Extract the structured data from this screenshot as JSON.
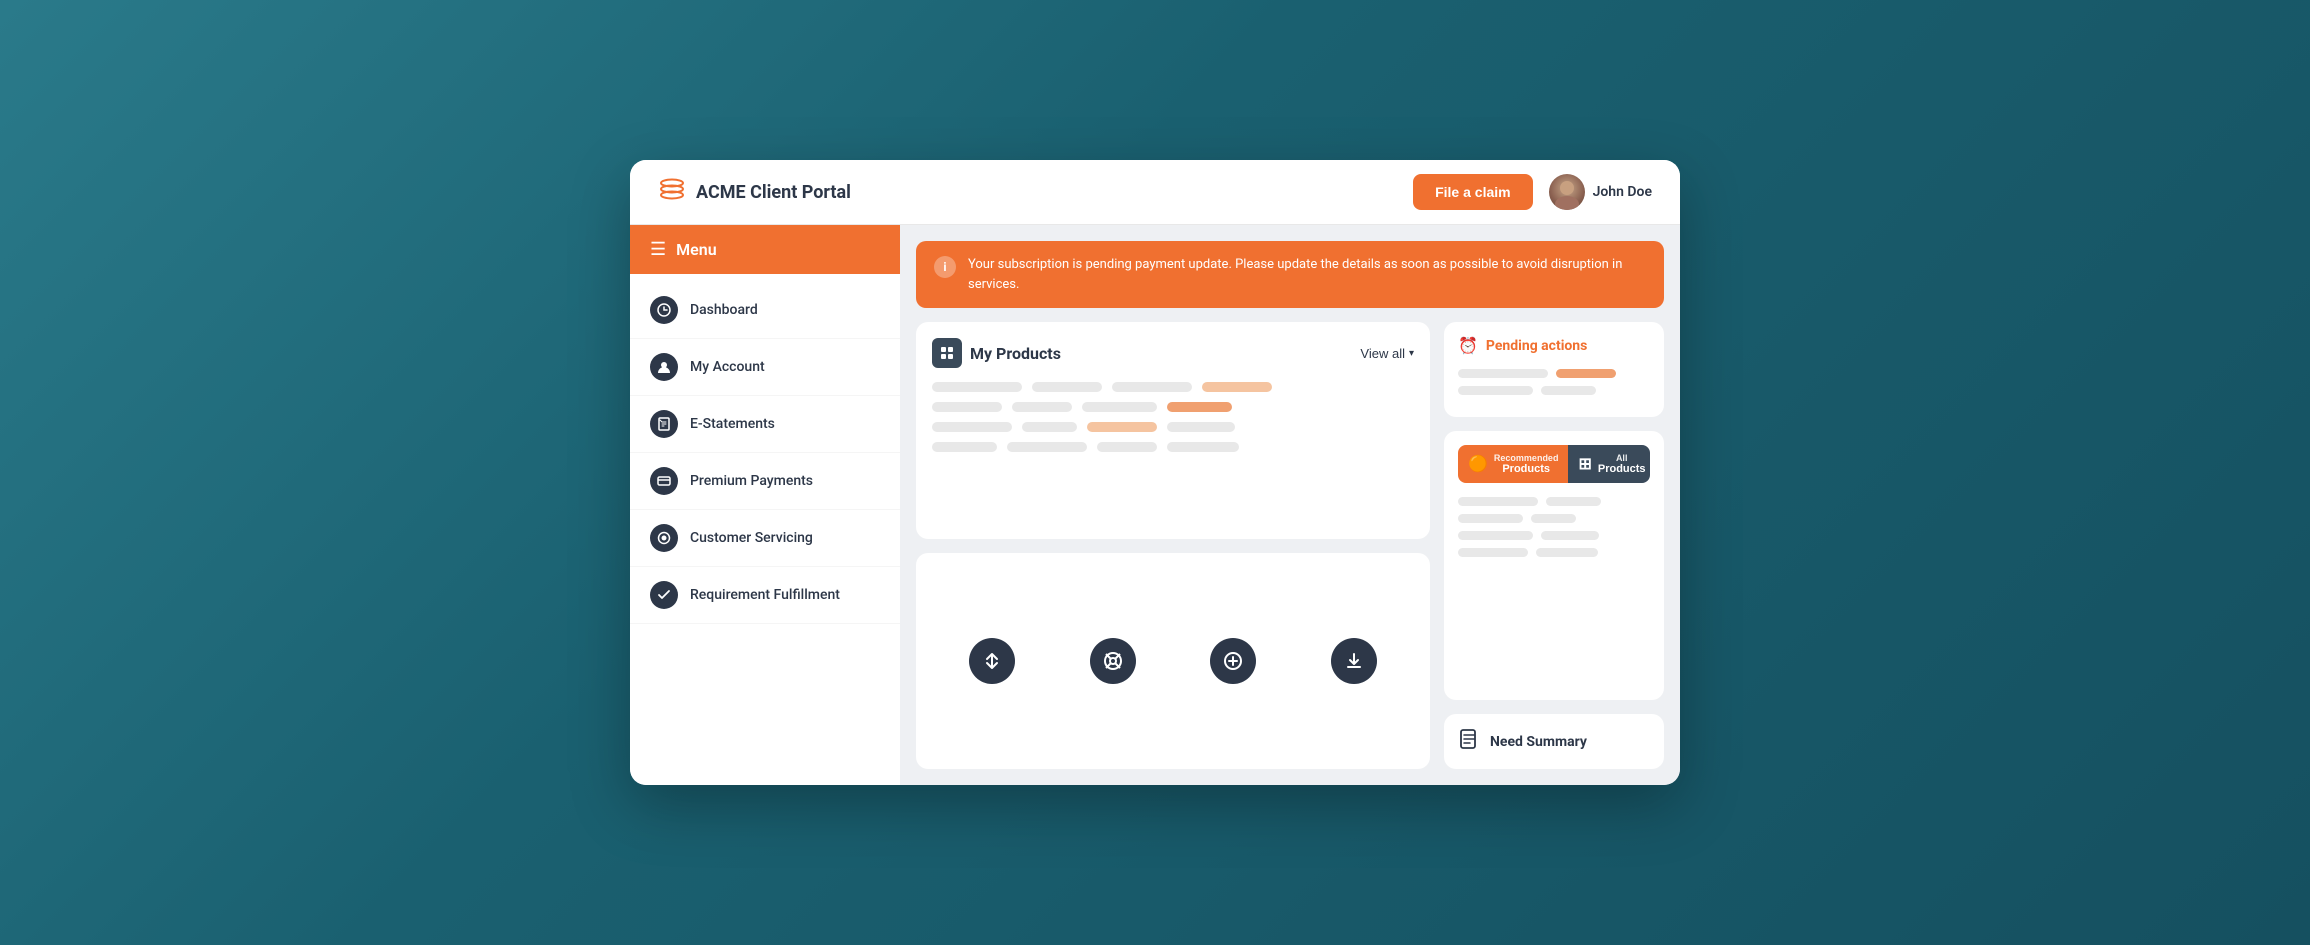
{
  "header": {
    "logo_text": "ACME Client Portal",
    "file_claim_label": "File a claim",
    "user_name": "John Doe"
  },
  "sidebar": {
    "menu_label": "Menu",
    "items": [
      {
        "id": "dashboard",
        "label": "Dashboard",
        "icon": "⚙"
      },
      {
        "id": "my-account",
        "label": "My Account",
        "icon": "👤"
      },
      {
        "id": "e-statements",
        "label": "E-Statements",
        "icon": "☑"
      },
      {
        "id": "premium-payments",
        "label": "Premium Payments",
        "icon": "💳"
      },
      {
        "id": "customer-servicing",
        "label": "Customer Servicing",
        "icon": "🔒"
      },
      {
        "id": "requirement-fulfillment",
        "label": "Requirement Fulfillment",
        "icon": "✏"
      }
    ]
  },
  "alert": {
    "message": "Your subscription is pending payment update. Please update the details as soon as possible to avoid disruption in services."
  },
  "my_products": {
    "title": "My Products",
    "view_all_label": "View all"
  },
  "pending_actions": {
    "title": "Pending actions"
  },
  "recommended_products": {
    "tab1_small": "Recommended",
    "tab1_label": "Products",
    "tab2_small": "All",
    "tab2_label": "Products"
  },
  "bottom_actions": {
    "icons": [
      "↕",
      "◎",
      "⊕",
      "⬇"
    ]
  },
  "need_summary": {
    "title": "Need Summary"
  }
}
